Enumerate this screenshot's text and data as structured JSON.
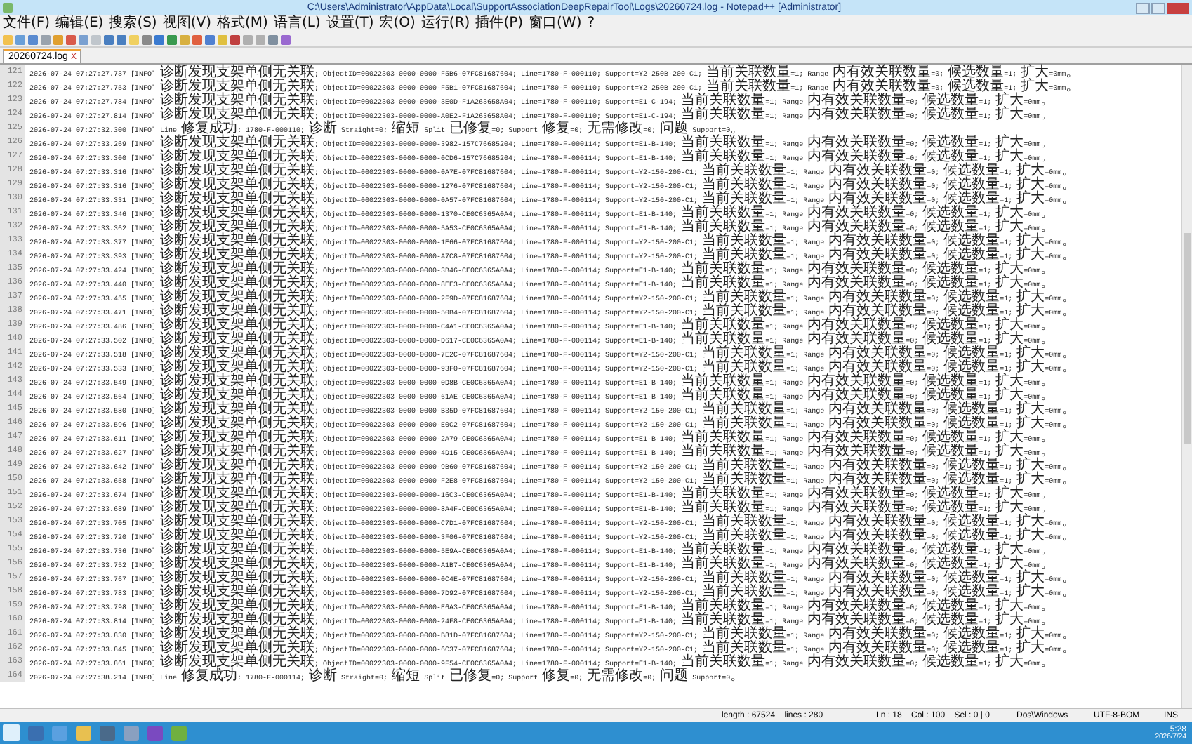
{
  "window": {
    "title": "C:\\Users\\Administrator\\AppData\\Local\\SupportAssociationDeepRepairTool\\Logs\\20260724.log - Notepad++ [Administrator]"
  },
  "menu": [
    "文件(F)",
    "编辑(E)",
    "搜索(S)",
    "视图(V)",
    "格式(M)",
    "语言(L)",
    "设置(T)",
    "宏(O)",
    "运行(R)",
    "插件(P)",
    "窗口(W)",
    "?"
  ],
  "close_tab_glyph": "X",
  "tabs": [
    {
      "label": "20260724.log",
      "selected": true
    }
  ],
  "lines": [
    {
      "number": "121",
      "text": "2026-07-24 07:27:27.737 [INFO] 诊断发现支架单侧无关联; ObjectID=00022303-0000-0000-F5B6-07FC81687604; Line=1780-F-000110; Support=Y2-250B-200-C1; 当前关联数量=1; Range 内有效关联数量=0; 候选数量=1; 扩大=0mm。"
    },
    {
      "number": "122",
      "text": "2026-07-24 07:27:27.753 [INFO] 诊断发现支架单侧无关联; ObjectID=00022303-0000-0000-F5B1-07FC81687604; Line=1780-F-000110; Support=Y2-250B-200-C1; 当前关联数量=1; Range 内有效关联数量=0; 候选数量=1; 扩大=0mm。"
    },
    {
      "number": "123",
      "text": "2026-07-24 07:27:27.784 [INFO] 诊断发现支架单侧无关联; ObjectID=00022303-0000-0000-3E0D-F1A263658A04; Line=1780-F-000110; Support=E1-C-194; 当前关联数量=1; Range 内有效关联数量=0; 候选数量=1; 扩大=0mm。"
    },
    {
      "number": "124",
      "text": "2026-07-24 07:27:27.814 [INFO] 诊断发现支架单侧无关联; ObjectID=00022303-0000-0000-A0E2-F1A263658A04; Line=1780-F-000110; Support=E1-C-194; 当前关联数量=1; Range 内有效关联数量=0; 候选数量=1; 扩大=0mm。"
    },
    {
      "number": "125",
      "text": "2026-07-24 07:27:32.300 [INFO] Line 修复成功: 1780-F-000110; 诊断 Straight=0; 缩短 Split 已修复=0; Support 修复=0; 无需修改=0; 问题 Support=0。"
    },
    {
      "number": "126",
      "text": "2026-07-24 07:27:33.269 [INFO] 诊断发现支架单侧无关联; ObjectID=00022303-0000-0000-3982-157C76685204; Line=1780-F-000114; Support=E1-B-140; 当前关联数量=1; Range 内有效关联数量=0; 候选数量=1; 扩大=0mm。"
    },
    {
      "number": "127",
      "text": "2026-07-24 07:27:33.300 [INFO] 诊断发现支架单侧无关联; ObjectID=00022303-0000-0000-0CD6-157C76685204; Line=1780-F-000114; Support=E1-B-140; 当前关联数量=1; Range 内有效关联数量=0; 候选数量=1; 扩大=0mm。"
    },
    {
      "number": "128",
      "text": "2026-07-24 07:27:33.316 [INFO] 诊断发现支架单侧无关联; ObjectID=00022303-0000-0000-0A7E-07FC81687604; Line=1780-F-000114; Support=Y2-150-200-C1; 当前关联数量=1; Range 内有效关联数量=0; 候选数量=1; 扩大=0mm。"
    },
    {
      "number": "129",
      "text": "2026-07-24 07:27:33.316 [INFO] 诊断发现支架单侧无关联; ObjectID=00022303-0000-0000-1276-07FC81687604; Line=1780-F-000114; Support=Y2-150-200-C1; 当前关联数量=1; Range 内有效关联数量=0; 候选数量=1; 扩大=0mm。"
    },
    {
      "number": "130",
      "text": "2026-07-24 07:27:33.331 [INFO] 诊断发现支架单侧无关联; ObjectID=00022303-0000-0000-0A57-07FC81687604; Line=1780-F-000114; Support=Y2-150-200-C1; 当前关联数量=1; Range 内有效关联数量=0; 候选数量=1; 扩大=0mm。"
    },
    {
      "number": "131",
      "text": "2026-07-24 07:27:33.346 [INFO] 诊断发现支架单侧无关联; ObjectID=00022303-0000-0000-1370-CE0C6365A0A4; Line=1780-F-000114; Support=E1-B-140; 当前关联数量=1; Range 内有效关联数量=0; 候选数量=1; 扩大=0mm。"
    },
    {
      "number": "132",
      "text": "2026-07-24 07:27:33.362 [INFO] 诊断发现支架单侧无关联; ObjectID=00022303-0000-0000-5A53-CE0C6365A0A4; Line=1780-F-000114; Support=E1-B-140; 当前关联数量=1; Range 内有效关联数量=0; 候选数量=1; 扩大=0mm。"
    },
    {
      "number": "133",
      "text": "2026-07-24 07:27:33.377 [INFO] 诊断发现支架单侧无关联; ObjectID=00022303-0000-0000-1E66-07FC81687604; Line=1780-F-000114; Support=Y2-150-200-C1; 当前关联数量=1; Range 内有效关联数量=0; 候选数量=1; 扩大=0mm。"
    },
    {
      "number": "134",
      "text": "2026-07-24 07:27:33.393 [INFO] 诊断发现支架单侧无关联; ObjectID=00022303-0000-0000-A7C8-07FC81687604; Line=1780-F-000114; Support=Y2-150-200-C1; 当前关联数量=1; Range 内有效关联数量=0; 候选数量=1; 扩大=0mm。"
    },
    {
      "number": "135",
      "text": "2026-07-24 07:27:33.424 [INFO] 诊断发现支架单侧无关联; ObjectID=00022303-0000-0000-3B46-CE0C6365A0A4; Line=1780-F-000114; Support=E1-B-140; 当前关联数量=1; Range 内有效关联数量=0; 候选数量=1; 扩大=0mm。"
    },
    {
      "number": "136",
      "text": "2026-07-24 07:27:33.440 [INFO] 诊断发现支架单侧无关联; ObjectID=00022303-0000-0000-8EE3-CE0C6365A0A4; Line=1780-F-000114; Support=E1-B-140; 当前关联数量=1; Range 内有效关联数量=0; 候选数量=1; 扩大=0mm。"
    },
    {
      "number": "137",
      "text": "2026-07-24 07:27:33.455 [INFO] 诊断发现支架单侧无关联; ObjectID=00022303-0000-0000-2F9D-07FC81687604; Line=1780-F-000114; Support=Y2-150-200-C1; 当前关联数量=1; Range 内有效关联数量=0; 候选数量=1; 扩大=0mm。"
    },
    {
      "number": "138",
      "text": "2026-07-24 07:27:33.471 [INFO] 诊断发现支架单侧无关联; ObjectID=00022303-0000-0000-50B4-07FC81687604; Line=1780-F-000114; Support=Y2-150-200-C1; 当前关联数量=1; Range 内有效关联数量=0; 候选数量=1; 扩大=0mm。"
    },
    {
      "number": "139",
      "text": "2026-07-24 07:27:33.486 [INFO] 诊断发现支架单侧无关联; ObjectID=00022303-0000-0000-C4A1-CE0C6365A0A4; Line=1780-F-000114; Support=E1-B-140; 当前关联数量=1; Range 内有效关联数量=0; 候选数量=1; 扩大=0mm。"
    },
    {
      "number": "140",
      "text": "2026-07-24 07:27:33.502 [INFO] 诊断发现支架单侧无关联; ObjectID=00022303-0000-0000-D617-CE0C6365A0A4; Line=1780-F-000114; Support=E1-B-140; 当前关联数量=1; Range 内有效关联数量=0; 候选数量=1; 扩大=0mm。"
    },
    {
      "number": "141",
      "text": "2026-07-24 07:27:33.518 [INFO] 诊断发现支架单侧无关联; ObjectID=00022303-0000-0000-7E2C-07FC81687604; Line=1780-F-000114; Support=Y2-150-200-C1; 当前关联数量=1; Range 内有效关联数量=0; 候选数量=1; 扩大=0mm。"
    },
    {
      "number": "142",
      "text": "2026-07-24 07:27:33.533 [INFO] 诊断发现支架单侧无关联; ObjectID=00022303-0000-0000-93F0-07FC81687604; Line=1780-F-000114; Support=Y2-150-200-C1; 当前关联数量=1; Range 内有效关联数量=0; 候选数量=1; 扩大=0mm。"
    },
    {
      "number": "143",
      "text": "2026-07-24 07:27:33.549 [INFO] 诊断发现支架单侧无关联; ObjectID=00022303-0000-0000-0D8B-CE0C6365A0A4; Line=1780-F-000114; Support=E1-B-140; 当前关联数量=1; Range 内有效关联数量=0; 候选数量=1; 扩大=0mm。"
    },
    {
      "number": "144",
      "text": "2026-07-24 07:27:33.564 [INFO] 诊断发现支架单侧无关联; ObjectID=00022303-0000-0000-61AE-CE0C6365A0A4; Line=1780-F-000114; Support=E1-B-140; 当前关联数量=1; Range 内有效关联数量=0; 候选数量=1; 扩大=0mm。"
    },
    {
      "number": "145",
      "text": "2026-07-24 07:27:33.580 [INFO] 诊断发现支架单侧无关联; ObjectID=00022303-0000-0000-B35D-07FC81687604; Line=1780-F-000114; Support=Y2-150-200-C1; 当前关联数量=1; Range 内有效关联数量=0; 候选数量=1; 扩大=0mm。"
    },
    {
      "number": "146",
      "text": "2026-07-24 07:27:33.596 [INFO] 诊断发现支架单侧无关联; ObjectID=00022303-0000-0000-E0C2-07FC81687604; Line=1780-F-000114; Support=Y2-150-200-C1; 当前关联数量=1; Range 内有效关联数量=0; 候选数量=1; 扩大=0mm。"
    },
    {
      "number": "147",
      "text": "2026-07-24 07:27:33.611 [INFO] 诊断发现支架单侧无关联; ObjectID=00022303-0000-0000-2A79-CE0C6365A0A4; Line=1780-F-000114; Support=E1-B-140; 当前关联数量=1; Range 内有效关联数量=0; 候选数量=1; 扩大=0mm。"
    },
    {
      "number": "148",
      "text": "2026-07-24 07:27:33.627 [INFO] 诊断发现支架单侧无关联; ObjectID=00022303-0000-0000-4D15-CE0C6365A0A4; Line=1780-F-000114; Support=E1-B-140; 当前关联数量=1; Range 内有效关联数量=0; 候选数量=1; 扩大=0mm。"
    },
    {
      "number": "149",
      "text": "2026-07-24 07:27:33.642 [INFO] 诊断发现支架单侧无关联; ObjectID=00022303-0000-0000-9B60-07FC81687604; Line=1780-F-000114; Support=Y2-150-200-C1; 当前关联数量=1; Range 内有效关联数量=0; 候选数量=1; 扩大=0mm。"
    },
    {
      "number": "150",
      "text": "2026-07-24 07:27:33.658 [INFO] 诊断发现支架单侧无关联; ObjectID=00022303-0000-0000-F2E8-07FC81687604; Line=1780-F-000114; Support=Y2-150-200-C1; 当前关联数量=1; Range 内有效关联数量=0; 候选数量=1; 扩大=0mm。"
    },
    {
      "number": "151",
      "text": "2026-07-24 07:27:33.674 [INFO] 诊断发现支架单侧无关联; ObjectID=00022303-0000-0000-16C3-CE0C6365A0A4; Line=1780-F-000114; Support=E1-B-140; 当前关联数量=1; Range 内有效关联数量=0; 候选数量=1; 扩大=0mm。"
    },
    {
      "number": "152",
      "text": "2026-07-24 07:27:33.689 [INFO] 诊断发现支架单侧无关联; ObjectID=00022303-0000-0000-8A4F-CE0C6365A0A4; Line=1780-F-000114; Support=E1-B-140; 当前关联数量=1; Range 内有效关联数量=0; 候选数量=1; 扩大=0mm。"
    },
    {
      "number": "153",
      "text": "2026-07-24 07:27:33.705 [INFO] 诊断发现支架单侧无关联; ObjectID=00022303-0000-0000-C7D1-07FC81687604; Line=1780-F-000114; Support=Y2-150-200-C1; 当前关联数量=1; Range 内有效关联数量=0; 候选数量=1; 扩大=0mm。"
    },
    {
      "number": "154",
      "text": "2026-07-24 07:27:33.720 [INFO] 诊断发现支架单侧无关联; ObjectID=00022303-0000-0000-3F06-07FC81687604; Line=1780-F-000114; Support=Y2-150-200-C1; 当前关联数量=1; Range 内有效关联数量=0; 候选数量=1; 扩大=0mm。"
    },
    {
      "number": "155",
      "text": "2026-07-24 07:27:33.736 [INFO] 诊断发现支架单侧无关联; ObjectID=00022303-0000-0000-5E9A-CE0C6365A0A4; Line=1780-F-000114; Support=E1-B-140; 当前关联数量=1; Range 内有效关联数量=0; 候选数量=1; 扩大=0mm。"
    },
    {
      "number": "156",
      "text": "2026-07-24 07:27:33.752 [INFO] 诊断发现支架单侧无关联; ObjectID=00022303-0000-0000-A1B7-CE0C6365A0A4; Line=1780-F-000114; Support=E1-B-140; 当前关联数量=1; Range 内有效关联数量=0; 候选数量=1; 扩大=0mm。"
    },
    {
      "number": "157",
      "text": "2026-07-24 07:27:33.767 [INFO] 诊断发现支架单侧无关联; ObjectID=00022303-0000-0000-0C4E-07FC81687604; Line=1780-F-000114; Support=Y2-150-200-C1; 当前关联数量=1; Range 内有效关联数量=0; 候选数量=1; 扩大=0mm。"
    },
    {
      "number": "158",
      "text": "2026-07-24 07:27:33.783 [INFO] 诊断发现支架单侧无关联; ObjectID=00022303-0000-0000-7D92-07FC81687604; Line=1780-F-000114; Support=Y2-150-200-C1; 当前关联数量=1; Range 内有效关联数量=0; 候选数量=1; 扩大=0mm。"
    },
    {
      "number": "159",
      "text": "2026-07-24 07:27:33.798 [INFO] 诊断发现支架单侧无关联; ObjectID=00022303-0000-0000-E6A3-CE0C6365A0A4; Line=1780-F-000114; Support=E1-B-140; 当前关联数量=1; Range 内有效关联数量=0; 候选数量=1; 扩大=0mm。"
    },
    {
      "number": "160",
      "text": "2026-07-24 07:27:33.814 [INFO] 诊断发现支架单侧无关联; ObjectID=00022303-0000-0000-24F8-CE0C6365A0A4; Line=1780-F-000114; Support=E1-B-140; 当前关联数量=1; Range 内有效关联数量=0; 候选数量=1; 扩大=0mm。"
    },
    {
      "number": "161",
      "text": "2026-07-24 07:27:33.830 [INFO] 诊断发现支架单侧无关联; ObjectID=00022303-0000-0000-B81D-07FC81687604; Line=1780-F-000114; Support=Y2-150-200-C1; 当前关联数量=1; Range 内有效关联数量=0; 候选数量=1; 扩大=0mm。"
    },
    {
      "number": "162",
      "text": "2026-07-24 07:27:33.845 [INFO] 诊断发现支架单侧无关联; ObjectID=00022303-0000-0000-6C37-07FC81687604; Line=1780-F-000114; Support=Y2-150-200-C1; 当前关联数量=1; Range 内有效关联数量=0; 候选数量=1; 扩大=0mm。"
    },
    {
      "number": "163",
      "text": "2026-07-24 07:27:33.861 [INFO] 诊断发现支架单侧无关联; ObjectID=00022303-0000-0000-9F54-CE0C6365A0A4; Line=1780-F-000114; Support=E1-B-140; 当前关联数量=1; Range 内有效关联数量=0; 候选数量=1; 扩大=0mm。"
    },
    {
      "number": "164",
      "text": "2026-07-24 07:27:38.214 [INFO] Line 修复成功: 1780-F-000114; 诊断 Straight=0; 缩短 Split 已修复=0; Support 修复=0; 无需修改=0; 问题 Support=0。"
    }
  ],
  "status_bar": {
    "length": "length : 67524    lines : 280",
    "position": "Ln : 18    Col : 100    Sel : 0 | 0",
    "eol": "Dos\\Windows",
    "encoding": "UTF-8-BOM",
    "mode": "INS"
  },
  "taskbar": {
    "time": "5:28",
    "date": "2026/7/24"
  }
}
